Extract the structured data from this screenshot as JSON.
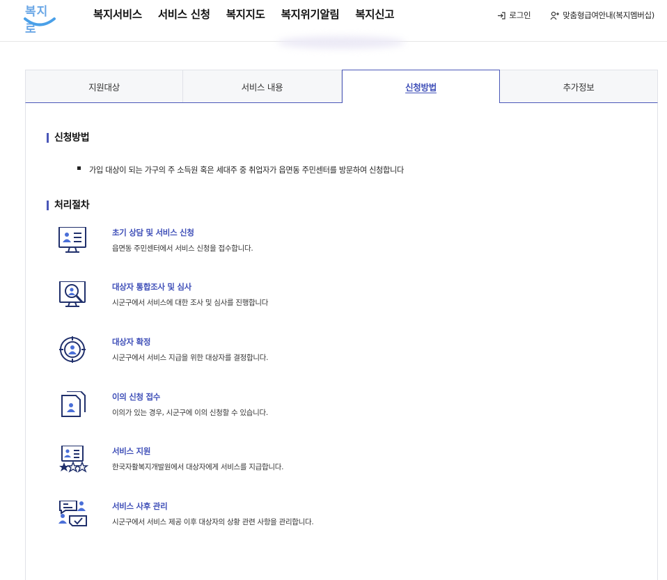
{
  "logo": {
    "text": "복지로"
  },
  "gnb": {
    "items": [
      "복지서비스",
      "서비스 신청",
      "복지지도",
      "복지위기알림",
      "복지신고"
    ]
  },
  "util": {
    "login": "로그인",
    "membership": "맞춤형급여안내(복지멤버십)"
  },
  "tabs": [
    {
      "label": "지원대상",
      "active": false
    },
    {
      "label": "서비스 내용",
      "active": false
    },
    {
      "label": "신청방법",
      "active": true
    },
    {
      "label": "추가정보",
      "active": false
    }
  ],
  "apply": {
    "title": "신청방법",
    "bullets": [
      "가입 대상이 되는 가구의 주 소득원 혹은 세대주 중 취업자가 읍면동 주민센터를 방문하여 신청합니다"
    ]
  },
  "process": {
    "title": "처리절차",
    "steps": [
      {
        "icon": "monitor-profile-icon",
        "title": "초기 상담 및 서비스 신청",
        "desc": "읍면동 주민센터에서 서비스 신청을 접수합니다."
      },
      {
        "icon": "magnifier-profile-icon",
        "title": "대상자 통합조사 및 심사",
        "desc": "시군구에서 서비스에 대한 조사 및 심사를 진행합니다"
      },
      {
        "icon": "target-person-icon",
        "title": "대상자 확정",
        "desc": "시군구에서 서비스 지급을 위한 대상자를 결정합니다."
      },
      {
        "icon": "documents-person-icon",
        "title": "이의 신청 접수",
        "desc": "이의가 있는 경우, 시군구에 이의 신청할 수 있습니다."
      },
      {
        "icon": "profile-stars-icon",
        "title": "서비스 지원",
        "desc": "한국자활복지개발원에서 대상자에게 서비스를 지급합니다."
      },
      {
        "icon": "chat-check-icon",
        "title": "서비스 사후 관리",
        "desc": "시군구에서 서비스 제공 이후 대상자의 상황 관련 사항을 관리합니다."
      }
    ]
  },
  "colors": {
    "accent": "#3f4fb8",
    "iconNavy": "#1f2f6b",
    "iconBlue": "#4a6fd8"
  }
}
